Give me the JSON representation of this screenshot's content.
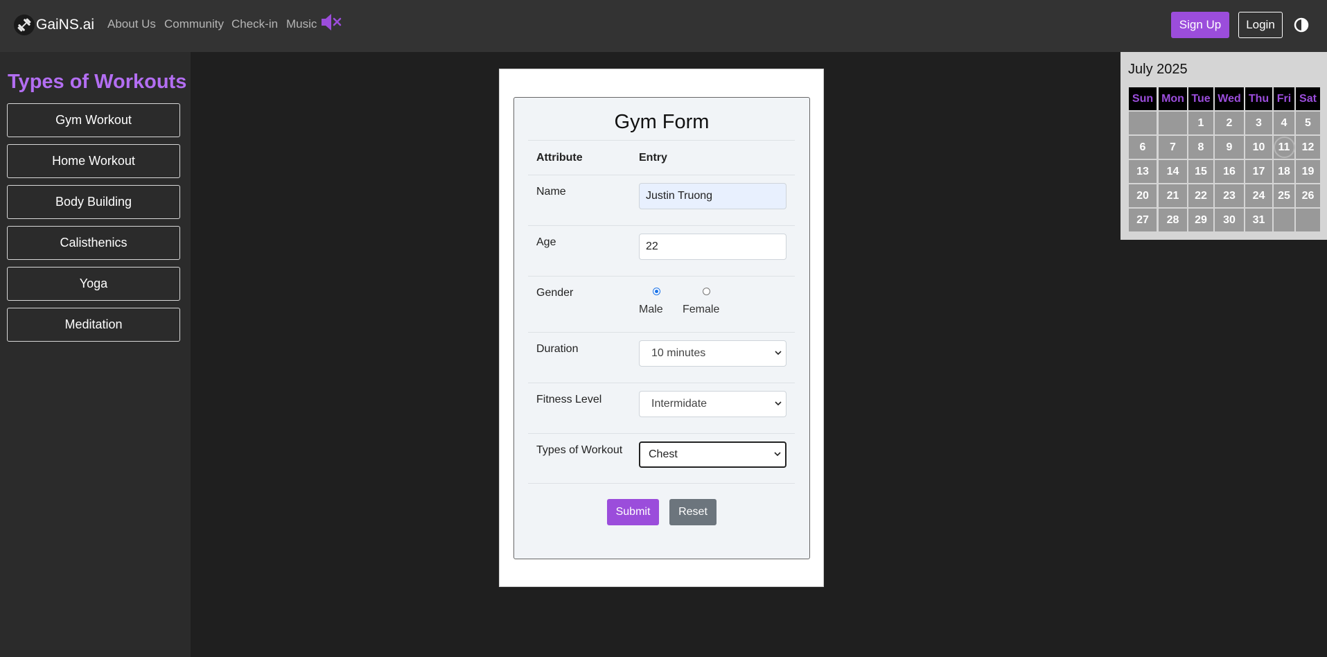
{
  "navbar": {
    "brand": "GaiNS.ai",
    "links": [
      "About Us",
      "Community",
      "Check-in",
      "Music"
    ],
    "signup_label": "Sign Up",
    "login_label": "Login",
    "icons": [
      "dumbbell-icon",
      "mute-icon",
      "theme-toggle-icon"
    ],
    "accent_color": "#9b4ddb"
  },
  "sidebar": {
    "title": "Types of Workouts",
    "items": [
      "Gym Workout",
      "Home Workout",
      "Body Building",
      "Calisthenics",
      "Yoga",
      "Meditation"
    ]
  },
  "form": {
    "title": "Gym Form",
    "col_attribute": "Attribute",
    "col_entry": "Entry",
    "name_label": "Name",
    "name_value": "Justin Truong",
    "age_label": "Age",
    "age_value": "22",
    "gender_label": "Gender",
    "gender_options": [
      "Male",
      "Female"
    ],
    "gender_selected": "Male",
    "duration_label": "Duration",
    "duration_value": "10 minutes",
    "fitness_label": "Fitness Level",
    "fitness_value": "Intermidate",
    "workout_label": "Types of Workout",
    "workout_value": "Chest",
    "submit_label": "Submit",
    "reset_label": "Reset"
  },
  "calendar": {
    "title": "July 2025",
    "weekdays": [
      "Sun",
      "Mon",
      "Tue",
      "Wed",
      "Thu",
      "Fri",
      "Sat"
    ],
    "weeks": [
      [
        "",
        "",
        "1",
        "2",
        "3",
        "4",
        "5"
      ],
      [
        "6",
        "7",
        "8",
        "9",
        "10",
        "11",
        "12"
      ],
      [
        "13",
        "14",
        "15",
        "16",
        "17",
        "18",
        "19"
      ],
      [
        "20",
        "21",
        "22",
        "23",
        "24",
        "25",
        "26"
      ],
      [
        "27",
        "28",
        "29",
        "30",
        "31",
        "",
        ""
      ]
    ],
    "today": "11"
  }
}
